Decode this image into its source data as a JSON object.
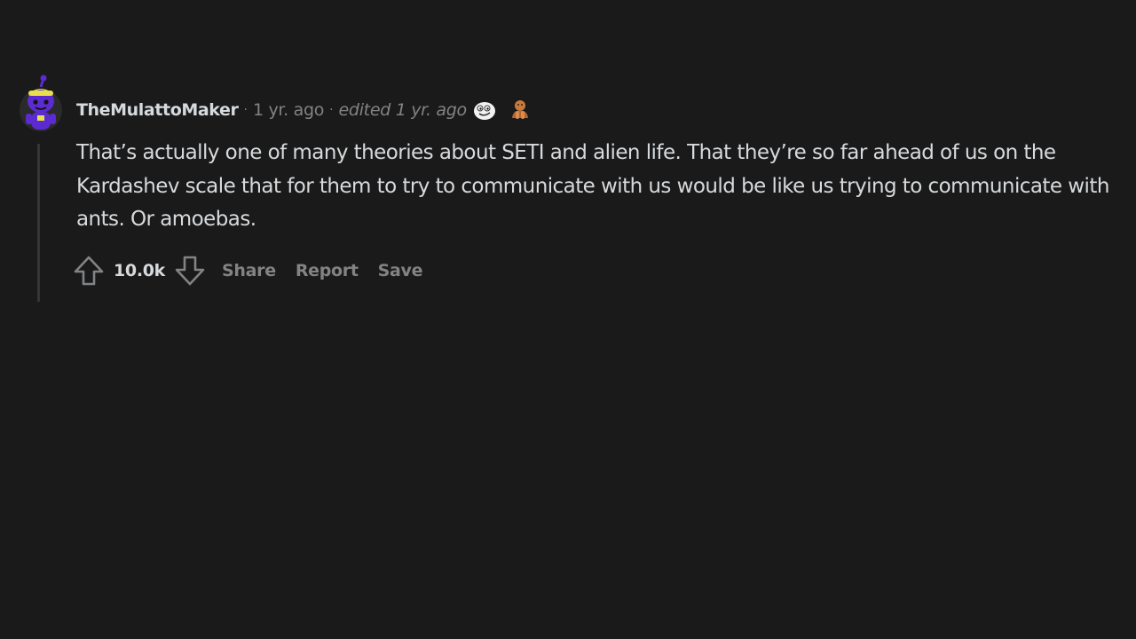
{
  "comment": {
    "author": "TheMulattoMaker",
    "separator": "·",
    "time": "1 yr. ago",
    "edited": "edited 1 yr. ago",
    "awards": [
      "face-award-icon",
      "hands-award-icon"
    ],
    "body": "That’s actually one of many theories about SETI and alien life. That they’re so far ahead of us on the Kardashev scale that for them to try to communicate with us would be like us trying to communicate with ants. Or amoebas.",
    "score": "10.0k",
    "actions": {
      "share": "Share",
      "report": "Report",
      "save": "Save"
    }
  },
  "colors": {
    "background": "#1a1a1b",
    "text": "#d7dadc",
    "muted": "#818384",
    "avatar": "#5b2bd1",
    "avatar_accent": "#e8e04a"
  }
}
